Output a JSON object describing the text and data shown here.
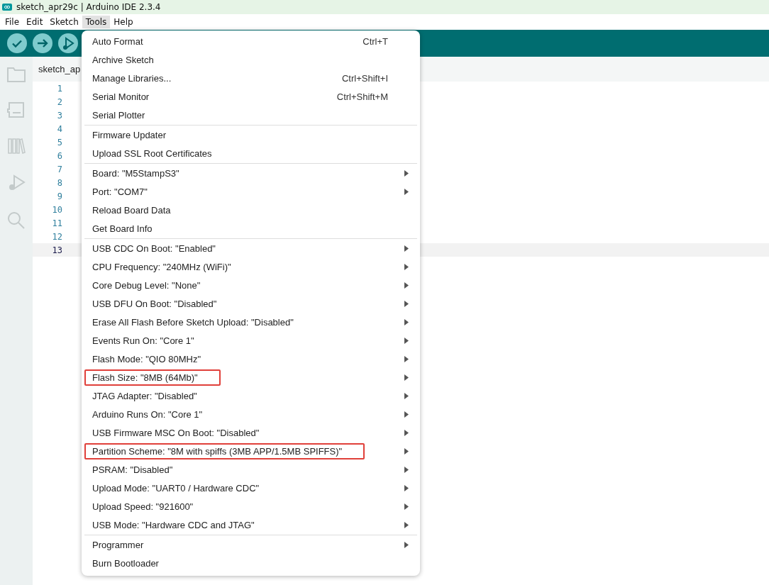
{
  "window": {
    "title": "sketch_apr29c | Arduino IDE 2.3.4"
  },
  "menubar": [
    {
      "label": "File",
      "selected": false
    },
    {
      "label": "Edit",
      "selected": false
    },
    {
      "label": "Sketch",
      "selected": false
    },
    {
      "label": "Tools",
      "selected": true
    },
    {
      "label": "Help",
      "selected": false
    }
  ],
  "editor": {
    "tab": "sketch_ap",
    "lines": [
      {
        "number": "1",
        "current": false
      },
      {
        "number": "2",
        "current": false
      },
      {
        "number": "3",
        "current": false
      },
      {
        "number": "4",
        "current": false
      },
      {
        "number": "5",
        "current": false
      },
      {
        "number": "6",
        "current": false
      },
      {
        "number": "7",
        "current": false
      },
      {
        "number": "8",
        "current": false
      },
      {
        "number": "9",
        "current": false
      },
      {
        "number": "10",
        "current": false
      },
      {
        "number": "11",
        "current": false
      },
      {
        "number": "12",
        "current": false
      },
      {
        "number": "13",
        "current": true
      }
    ]
  },
  "tools_menu": [
    {
      "items": [
        {
          "label": "Auto Format",
          "shortcut": "Ctrl+T",
          "submenu": false,
          "highlighted": false
        },
        {
          "label": "Archive Sketch",
          "submenu": false,
          "highlighted": false
        },
        {
          "label": "Manage Libraries...",
          "shortcut": "Ctrl+Shift+I",
          "submenu": false,
          "highlighted": false
        },
        {
          "label": "Serial Monitor",
          "shortcut": "Ctrl+Shift+M",
          "submenu": false,
          "highlighted": false
        },
        {
          "label": "Serial Plotter",
          "submenu": false,
          "highlighted": false
        }
      ]
    },
    {
      "items": [
        {
          "label": "Firmware Updater",
          "submenu": false,
          "highlighted": false
        },
        {
          "label": "Upload SSL Root Certificates",
          "submenu": false,
          "highlighted": false
        }
      ]
    },
    {
      "items": [
        {
          "label": "Board: \"M5StampS3\"",
          "submenu": true,
          "highlighted": false
        },
        {
          "label": "Port: \"COM7\"",
          "submenu": true,
          "highlighted": false
        },
        {
          "label": "Reload Board Data",
          "submenu": false,
          "highlighted": false
        },
        {
          "label": "Get Board Info",
          "submenu": false,
          "highlighted": false
        }
      ]
    },
    {
      "items": [
        {
          "label": "USB CDC On Boot: \"Enabled\"",
          "submenu": true,
          "highlighted": false
        },
        {
          "label": "CPU Frequency: \"240MHz (WiFi)\"",
          "submenu": true,
          "highlighted": false
        },
        {
          "label": "Core Debug Level: \"None\"",
          "submenu": true,
          "highlighted": false
        },
        {
          "label": "USB DFU On Boot: \"Disabled\"",
          "submenu": true,
          "highlighted": false
        },
        {
          "label": "Erase All Flash Before Sketch Upload: \"Disabled\"",
          "submenu": true,
          "highlighted": false
        },
        {
          "label": "Events Run On: \"Core 1\"",
          "submenu": true,
          "highlighted": false
        },
        {
          "label": "Flash Mode: \"QIO 80MHz\"",
          "submenu": true,
          "highlighted": false
        },
        {
          "label": "Flash Size: \"8MB (64Mb)\"",
          "submenu": true,
          "highlighted": true
        },
        {
          "label": "JTAG Adapter: \"Disabled\"",
          "submenu": true,
          "highlighted": false
        },
        {
          "label": "Arduino Runs On: \"Core 1\"",
          "submenu": true,
          "highlighted": false
        },
        {
          "label": "USB Firmware MSC On Boot: \"Disabled\"",
          "submenu": true,
          "highlighted": false
        },
        {
          "label": "Partition Scheme: \"8M with spiffs (3MB APP/1.5MB SPIFFS)\"",
          "submenu": true,
          "highlighted": true
        },
        {
          "label": "PSRAM: \"Disabled\"",
          "submenu": true,
          "highlighted": false
        },
        {
          "label": "Upload Mode: \"UART0 / Hardware CDC\"",
          "submenu": true,
          "highlighted": false
        },
        {
          "label": "Upload Speed: \"921600\"",
          "submenu": true,
          "highlighted": false
        },
        {
          "label": "USB Mode: \"Hardware CDC and JTAG\"",
          "submenu": true,
          "highlighted": false
        }
      ]
    },
    {
      "items": [
        {
          "label": "Programmer",
          "submenu": true,
          "highlighted": false
        },
        {
          "label": "Burn Bootloader",
          "submenu": false,
          "highlighted": false
        }
      ]
    }
  ]
}
